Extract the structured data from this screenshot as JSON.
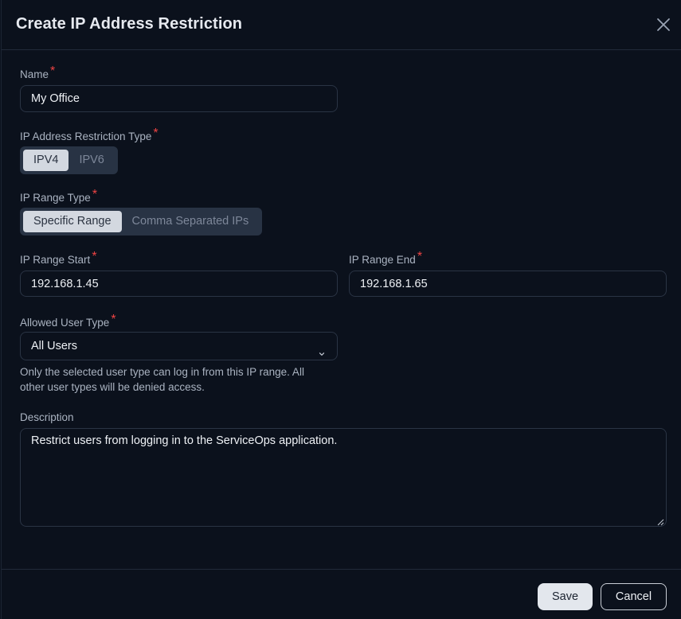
{
  "dialog": {
    "title": "Create IP Address Restriction",
    "close_icon": "close-icon"
  },
  "form": {
    "name": {
      "label": "Name",
      "required": "*",
      "value": "My Office"
    },
    "restriction_type": {
      "label": "IP Address Restriction Type",
      "required": "*",
      "options": [
        "IPV4",
        "IPV6"
      ],
      "selected": "IPV4"
    },
    "range_type": {
      "label": "IP Range Type",
      "required": "*",
      "options": [
        "Specific Range",
        "Comma Separated IPs"
      ],
      "selected": "Specific Range"
    },
    "range_start": {
      "label": "IP Range Start",
      "required": "*",
      "value": "192.168.1.45"
    },
    "range_end": {
      "label": "IP Range End",
      "required": "*",
      "value": "192.168.1.65"
    },
    "allowed_user_type": {
      "label": "Allowed User Type",
      "required": "*",
      "value": "All Users",
      "icon": "chevron-down-icon",
      "help_line1": "Only the selected user type can log in from this IP range. All",
      "help_line2": "other user types will be denied access."
    },
    "description": {
      "label": "Description",
      "value": "Restrict users from logging in to the ServiceOps application."
    }
  },
  "footer": {
    "save_label": "Save",
    "cancel_label": "Cancel"
  },
  "colors": {
    "background": "#0b111c",
    "required": "#ef4444",
    "segment_bg": "#283344",
    "segment_active": "#d3d8e0"
  }
}
